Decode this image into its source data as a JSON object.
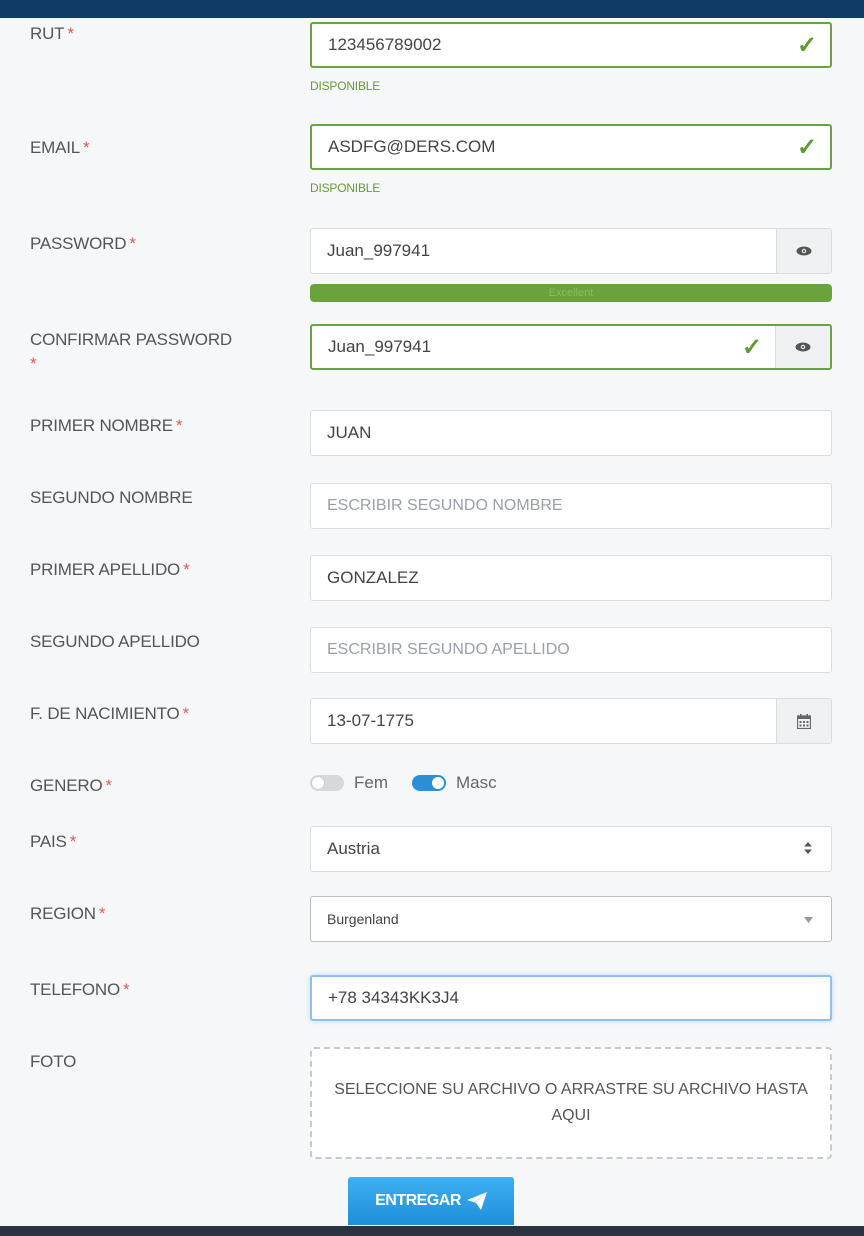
{
  "form": {
    "required_mark": "*",
    "rut": {
      "label": "RUT",
      "value": "123456789002",
      "status": "DISPONIBLE"
    },
    "email": {
      "label": "EMAIL",
      "value": "ASDFG@DERS.COM",
      "status": "DISPONIBLE"
    },
    "password": {
      "label": "PASSWORD",
      "value": "Juan_997941",
      "strength_label": "Excellent",
      "strength_fraction": 1.0
    },
    "confirm_password": {
      "label": "CONFIRMAR PASSWORD",
      "value": "Juan_997941"
    },
    "first_name": {
      "label": "PRIMER NOMBRE",
      "value": "JUAN"
    },
    "second_name": {
      "label": "SEGUNDO NOMBRE",
      "placeholder": "ESCRIBIR  SEGUNDO NOMBRE"
    },
    "first_surname": {
      "label": "PRIMER APELLIDO",
      "value": "GONZALEZ"
    },
    "second_surname": {
      "label": "SEGUNDO APELLIDO",
      "placeholder": "ESCRIBIR  SEGUNDO APELLIDO"
    },
    "birthdate": {
      "label": "F. DE NACIMIENTO",
      "value": "13-07-1775"
    },
    "gender": {
      "label": "GENERO",
      "options": [
        {
          "label": "Fem",
          "on": false
        },
        {
          "label": "Masc",
          "on": true
        }
      ]
    },
    "country": {
      "label": "PAIS",
      "value": "Austria"
    },
    "region": {
      "label": "REGION",
      "value": "Burgenland"
    },
    "phone": {
      "label": "TELEFONO",
      "value": "+78 34343KK3J4"
    },
    "photo": {
      "label": "FOTO",
      "dropzone_text": "SELECCIONE SU ARCHIVO O ARRASTRE SU ARCHIVO HASTA AQUI"
    },
    "submit_label": "ENTREGAR"
  },
  "icons": {
    "valid": "check-icon",
    "reveal": "eye-icon",
    "calendar": "calendar-icon",
    "select": "updown-arrow-icon",
    "dropdown": "caret-down-icon",
    "submit": "paper-plane-icon"
  },
  "colors": {
    "header": "#0f3b66",
    "valid": "#6aa33b",
    "required": "#e05a5a",
    "accent": "#2b8fd6"
  }
}
